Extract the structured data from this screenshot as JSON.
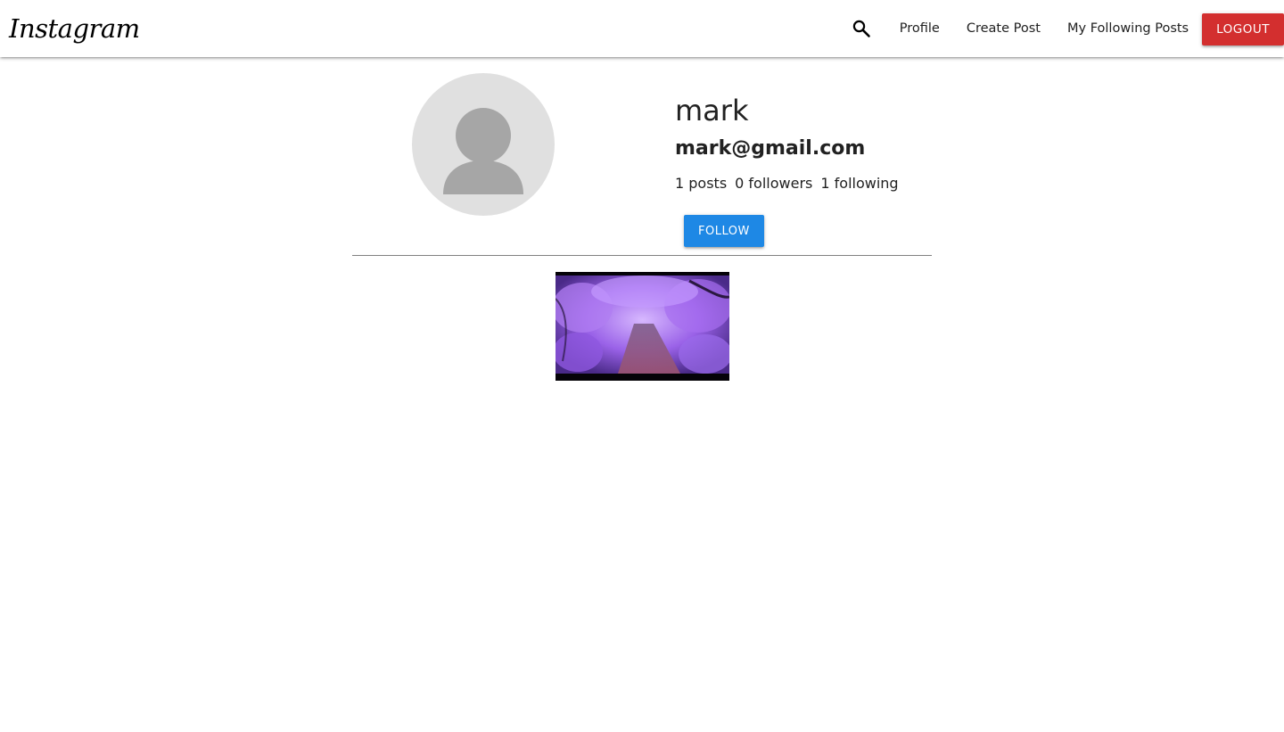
{
  "navbar": {
    "brand": "Instagram",
    "search_icon": "search-icon",
    "links": [
      "Profile",
      "Create Post",
      "My Following Posts"
    ],
    "logout_label": "LOGOUT",
    "logout_color": "#d32f2f"
  },
  "profile": {
    "username": "mark",
    "email": "mark@gmail.com",
    "stats": {
      "posts": "1 posts",
      "followers": "0 followers",
      "following": "1 following"
    },
    "follow_label": "FOLLOW",
    "follow_color": "#1e88e5",
    "avatar_icon": "default-avatar-icon"
  },
  "gallery": {
    "posts": [
      {
        "image": "purple-wisteria-forest-path"
      }
    ]
  }
}
